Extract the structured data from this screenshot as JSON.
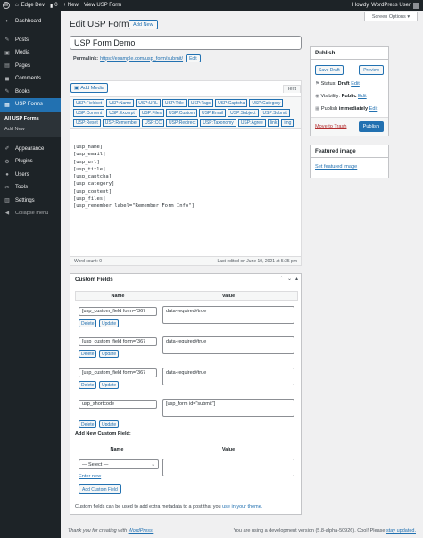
{
  "adminbar": {
    "site_name": "Edge Dev",
    "comments_count": "0",
    "new_label": "+ New",
    "view_label": "View USP Form",
    "howdy": "Howdy, WordPress User"
  },
  "sidebar": {
    "items": [
      {
        "label": "Dashboard",
        "icon": "dashboard-icon",
        "glyph": "◐"
      },
      {
        "label": "Posts",
        "icon": "pin-icon",
        "glyph": "✎"
      },
      {
        "label": "Media",
        "icon": "media-icon",
        "glyph": "▣"
      },
      {
        "label": "Pages",
        "icon": "pages-icon",
        "glyph": "▤"
      },
      {
        "label": "Comments",
        "icon": "comments-icon",
        "glyph": "◼"
      },
      {
        "label": "Books",
        "icon": "books-icon",
        "glyph": "✎"
      },
      {
        "label": "USP Forms",
        "icon": "forms-icon",
        "glyph": "▦"
      },
      {
        "label": "Appearance",
        "icon": "appearance-icon",
        "glyph": "✐"
      },
      {
        "label": "Plugins",
        "icon": "plugins-icon",
        "glyph": "⚙"
      },
      {
        "label": "Users",
        "icon": "users-icon",
        "glyph": "●"
      },
      {
        "label": "Tools",
        "icon": "tools-icon",
        "glyph": "✂"
      },
      {
        "label": "Settings",
        "icon": "settings-icon",
        "glyph": "▥"
      }
    ],
    "sub_items": [
      "All USP Forms",
      "Add New"
    ],
    "collapse_label": "Collapse menu"
  },
  "screen_options": "Screen Options ▾",
  "page": {
    "title": "Edit USP Form",
    "add_new": "Add New",
    "post_title": "USP Form Demo",
    "permalink_label": "Permalink:",
    "permalink_url": "https://example.com/usp_form/submit/",
    "edit_label": "Edit"
  },
  "editor": {
    "add_media": "Add Media",
    "text_tab": "Text",
    "quicktags": [
      "USP:Fieldset",
      "USP:Name",
      "USP:URL",
      "USP:Title",
      "USP:Tags",
      "USP:Captcha",
      "USP:Category",
      "USP:Content",
      "USP:Excerpt",
      "USP:Files",
      "USP:Custom",
      "USP:Email",
      "USP:Subject",
      "USP:Submit",
      "USP:Reset",
      "USP:Remember",
      "USP:CC",
      "USP:Redirect",
      "USP:Taxonomy",
      "USP:Agree",
      "link",
      "img"
    ],
    "content": "[usp_name]\n[usp_email]\n[usp_url]\n[usp_title]\n[usp_captcha]\n[usp_category]\n[usp_content]\n[usp_files]\n[usp_remember label=\"Remember Form Info\"]",
    "word_count": "Word count: 0",
    "last_edited": "Last edited on June 10, 2021 at 5:35 pm"
  },
  "custom_fields": {
    "title": "Custom Fields",
    "col_name": "Name",
    "col_value": "Value",
    "rows": [
      {
        "name": "[usp_custom_field form=\"367",
        "value": "data-required#true"
      },
      {
        "name": "[usp_custom_field form=\"367",
        "value": "data-required#true"
      },
      {
        "name": "[usp_custom_field form=\"367",
        "value": "data-required#true"
      }
    ],
    "last_row": {
      "name": "usp_shortcode",
      "value": "[usp_form id=\"submit\"]"
    },
    "delete_label": "Delete",
    "update_label": "Update",
    "add_new_title": "Add New Custom Field:",
    "select_default": "— Select —",
    "enter_new": "Enter new",
    "add_button": "Add Custom Field",
    "help_text": "Custom fields can be used to add extra metadata to a post that you",
    "help_link": "use in your theme."
  },
  "publish": {
    "title": "Publish",
    "save_draft": "Save Draft",
    "preview": "Preview",
    "status_label": "Status:",
    "status_value": "Draft",
    "visibility_label": "Visibility:",
    "visibility_value": "Public",
    "publish_label": "Publish",
    "publish_value": "immediately",
    "edit": "Edit",
    "trash": "Move to Trash",
    "publish_button": "Publish"
  },
  "featured": {
    "title": "Featured image",
    "set_link": "Set featured image"
  },
  "footer": {
    "thanks": "Thank you for creating with",
    "thanks_link": "WordPress.",
    "version": "You are using a development version (5.8-alpha-50926). Cool! Please",
    "version_link": "stay updated."
  }
}
